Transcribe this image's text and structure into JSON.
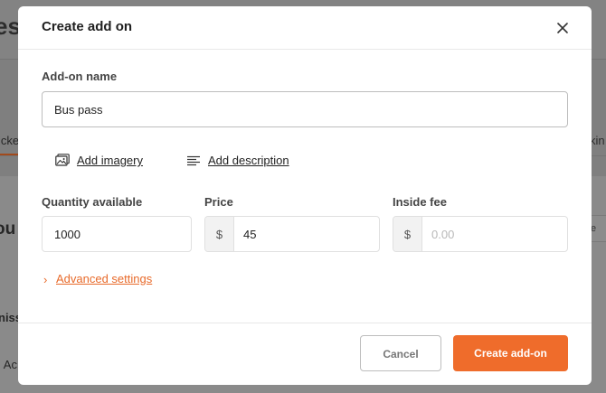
{
  "background": {
    "title_fragment": "es",
    "tab_left_fragment": "icke",
    "tab_right_fragment": "kin",
    "heading_fragment": "ou",
    "button_fragment": "e",
    "column_fragment": "niss",
    "row_fragment": "l Ac"
  },
  "modal": {
    "title": "Create add on",
    "close_icon": "close-icon",
    "name_label": "Add-on name",
    "name_value": "Bus pass",
    "add_imagery": "Add imagery",
    "add_description": "Add description",
    "quantity_label": "Quantity available",
    "quantity_value": "1000",
    "price_label": "Price",
    "price_prefix": "$",
    "price_value": "45",
    "fee_label": "Inside fee",
    "fee_prefix": "$",
    "fee_placeholder": "0.00",
    "advanced_chevron": "›",
    "advanced_settings": "Advanced settings",
    "cancel_label": "Cancel",
    "create_label": "Create add-on"
  },
  "colors": {
    "accent": "#ef6c2b",
    "overlay": "#7f7f7f"
  }
}
